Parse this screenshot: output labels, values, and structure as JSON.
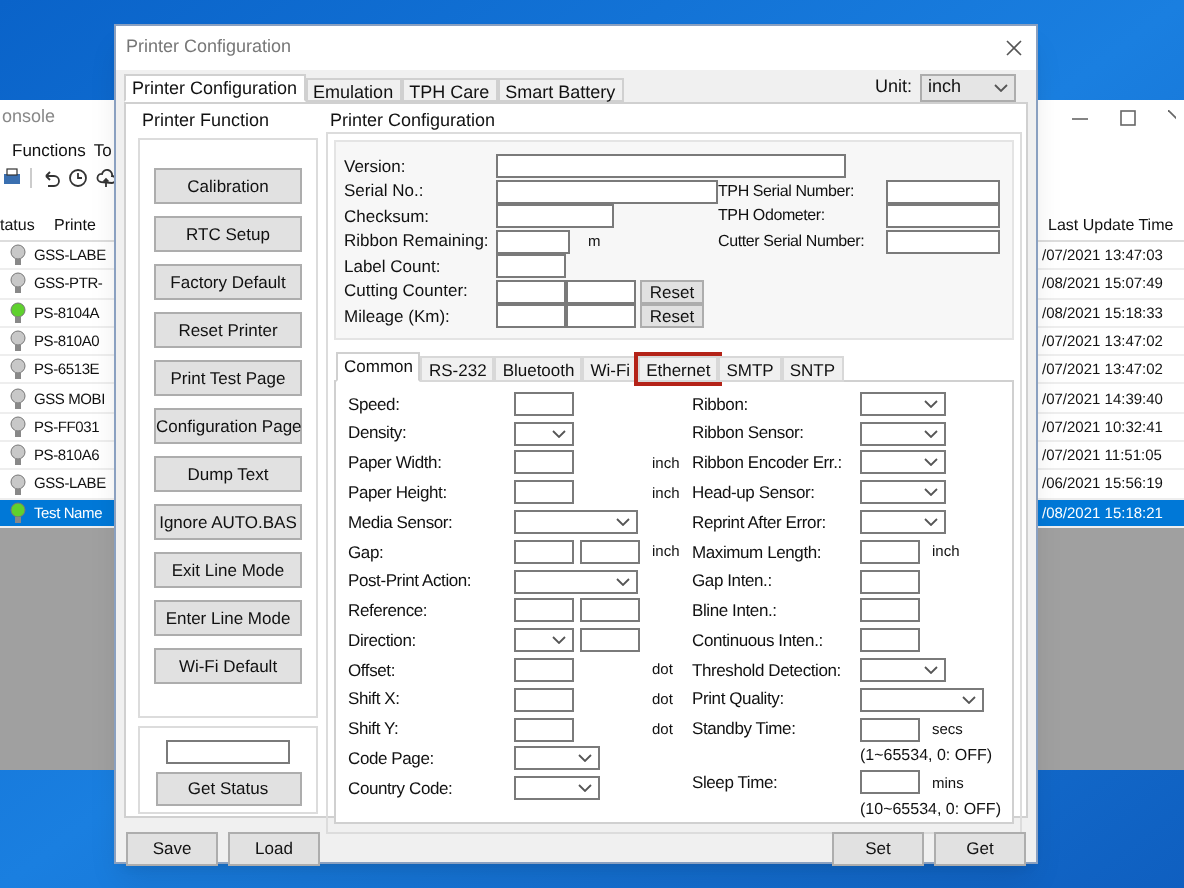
{
  "console_window": {
    "title": "onsole",
    "menu": [
      "Functions",
      "To"
    ],
    "columns": [
      "tatus",
      "Printe",
      "Last Update Time"
    ],
    "rows": [
      {
        "online": false,
        "name": "GSS-LABE",
        "last_update": "/07/2021 13:47:03",
        "selected": false
      },
      {
        "online": false,
        "name": "GSS-PTR-",
        "last_update": "/08/2021 15:07:49",
        "selected": false
      },
      {
        "online": true,
        "name": "PS-8104A",
        "last_update": "/08/2021 15:18:33",
        "selected": false
      },
      {
        "online": false,
        "name": "PS-810A0",
        "last_update": "/07/2021 13:47:02",
        "selected": false
      },
      {
        "online": false,
        "name": "PS-6513E",
        "last_update": "/07/2021 13:47:02",
        "selected": false
      },
      {
        "online": false,
        "name": "GSS MOBI",
        "last_update": "/07/2021 14:39:40",
        "selected": false
      },
      {
        "online": false,
        "name": "PS-FF031",
        "last_update": "/07/2021 10:32:41",
        "selected": false
      },
      {
        "online": false,
        "name": "PS-810A6",
        "last_update": "/07/2021 11:51:05",
        "selected": false
      },
      {
        "online": false,
        "name": "GSS-LABE",
        "last_update": "/06/2021 15:56:19",
        "selected": false
      },
      {
        "online": true,
        "name": "Test Name",
        "last_update": "/08/2021 15:18:21",
        "selected": true
      }
    ]
  },
  "dialog": {
    "title": "Printer Configuration",
    "tabs": [
      {
        "label": "Printer Configuration",
        "selected": true
      },
      {
        "label": "Emulation",
        "selected": false
      },
      {
        "label": "TPH Care",
        "selected": false
      },
      {
        "label": "Smart Battery",
        "selected": false
      }
    ],
    "unit_label": "Unit:",
    "unit_value": "inch",
    "printer_function": {
      "title": "Printer Function",
      "buttons": [
        "Calibration",
        "RTC Setup",
        "Factory Default",
        "Reset Printer",
        "Print Test Page",
        "Configuration Page",
        "Dump Text",
        "Ignore AUTO.BAS",
        "Exit Line Mode",
        "Enter Line Mode",
        "Wi-Fi Default"
      ],
      "get_status": "Get Status"
    },
    "printer_configuration": {
      "title": "Printer Configuration",
      "info_left": [
        {
          "label": "Version:",
          "kind": "long"
        },
        {
          "label": "Serial No.:",
          "kind": "medium"
        },
        {
          "label": "Checksum:",
          "kind": "short"
        },
        {
          "label": "Ribbon Remaining:",
          "kind": "unit",
          "unit": "m"
        },
        {
          "label": "Label Count:",
          "kind": "small"
        },
        {
          "label": "Cutting Counter:",
          "kind": "reset",
          "button": "Reset"
        },
        {
          "label": "Mileage (Km):",
          "kind": "reset",
          "button": "Reset"
        }
      ],
      "info_right": [
        "TPH Serial Number:",
        "TPH Odometer:",
        "Cutter Serial Number:"
      ],
      "subtabs": [
        {
          "label": "Common",
          "selected": true,
          "highlighted": false
        },
        {
          "label": "RS-232",
          "selected": false,
          "highlighted": false
        },
        {
          "label": "Bluetooth",
          "selected": false,
          "highlighted": false
        },
        {
          "label": "Wi-Fi",
          "selected": false,
          "highlighted": false
        },
        {
          "label": "Ethernet",
          "selected": false,
          "highlighted": true
        },
        {
          "label": "SMTP",
          "selected": false,
          "highlighted": false
        },
        {
          "label": "SNTP",
          "selected": false,
          "highlighted": false
        }
      ],
      "left_fields": [
        {
          "kind": "field",
          "label": "Speed:",
          "controls": [
            {
              "kind": "input"
            }
          ]
        },
        {
          "kind": "field",
          "label": "Density:",
          "controls": [
            {
              "kind": "dropdown"
            }
          ]
        },
        {
          "kind": "field",
          "label": "Paper Width:",
          "controls": [
            {
              "kind": "input"
            }
          ],
          "unit": "inch"
        },
        {
          "kind": "field",
          "label": "Paper Height:",
          "controls": [
            {
              "kind": "input"
            }
          ],
          "unit": "inch"
        },
        {
          "kind": "field",
          "label": "Media Sensor:",
          "controls": [
            {
              "kind": "dropdown_wide"
            }
          ]
        },
        {
          "kind": "field",
          "label": "Gap:",
          "controls": [
            {
              "kind": "input"
            },
            {
              "kind": "input"
            }
          ],
          "unit": "inch"
        },
        {
          "kind": "field",
          "label": "Post-Print Action:",
          "controls": [
            {
              "kind": "dropdown_wide"
            }
          ]
        },
        {
          "kind": "field",
          "label": "Reference:",
          "controls": [
            {
              "kind": "input"
            },
            {
              "kind": "input"
            }
          ]
        },
        {
          "kind": "field",
          "label": "Direction:",
          "controls": [
            {
              "kind": "dropdown"
            },
            {
              "kind": "input"
            }
          ]
        },
        {
          "kind": "field",
          "label": "Offset:",
          "controls": [
            {
              "kind": "input"
            }
          ],
          "unit": "dot"
        },
        {
          "kind": "field",
          "label": "Shift X:",
          "controls": [
            {
              "kind": "input"
            }
          ],
          "unit": "dot"
        },
        {
          "kind": "field",
          "label": "Shift Y:",
          "controls": [
            {
              "kind": "input"
            }
          ],
          "unit": "dot"
        },
        {
          "kind": "field",
          "label": "Code Page:",
          "controls": [
            {
              "kind": "dropdown_mid"
            }
          ]
        },
        {
          "kind": "field",
          "label": "Country Code:",
          "controls": [
            {
              "kind": "dropdown_mid"
            }
          ]
        }
      ],
      "right_fields": [
        {
          "kind": "field",
          "label": "Ribbon:",
          "controls": [
            {
              "kind": "dropdown_mid"
            }
          ]
        },
        {
          "kind": "field",
          "label": "Ribbon Sensor:",
          "controls": [
            {
              "kind": "dropdown_mid"
            }
          ]
        },
        {
          "kind": "field",
          "label": "Ribbon Encoder Err.:",
          "controls": [
            {
              "kind": "dropdown_mid"
            }
          ]
        },
        {
          "kind": "field",
          "label": "Head-up Sensor:",
          "controls": [
            {
              "kind": "dropdown_mid"
            }
          ]
        },
        {
          "kind": "field",
          "label": "Reprint After Error:",
          "controls": [
            {
              "kind": "dropdown_mid"
            }
          ]
        },
        {
          "kind": "field",
          "label": "Maximum Length:",
          "controls": [
            {
              "kind": "input"
            }
          ],
          "unit": "inch"
        },
        {
          "kind": "field",
          "label": "Gap Inten.:",
          "controls": [
            {
              "kind": "input"
            }
          ]
        },
        {
          "kind": "field",
          "label": "Bline Inten.:",
          "controls": [
            {
              "kind": "input"
            }
          ]
        },
        {
          "kind": "field",
          "label": "Continuous Inten.:",
          "controls": [
            {
              "kind": "input"
            }
          ]
        },
        {
          "kind": "field",
          "label": "Threshold Detection:",
          "controls": [
            {
              "kind": "dropdown_mid"
            }
          ]
        },
        {
          "kind": "field",
          "label": "Print Quality:",
          "controls": [
            {
              "kind": "dropdown_wide"
            }
          ]
        },
        {
          "kind": "field",
          "label": "Standby Time:",
          "controls": [
            {
              "kind": "input"
            }
          ],
          "unit": "secs"
        },
        {
          "kind": "hint",
          "text": "(1~65534, 0: OFF)"
        },
        {
          "kind": "field",
          "label": "Sleep Time:",
          "controls": [
            {
              "kind": "input"
            }
          ],
          "unit": "mins"
        },
        {
          "kind": "hint",
          "text": "(10~65534, 0: OFF)"
        }
      ]
    },
    "footer_left": [
      "Save",
      "Load"
    ],
    "footer_right": [
      "Set",
      "Get"
    ]
  }
}
